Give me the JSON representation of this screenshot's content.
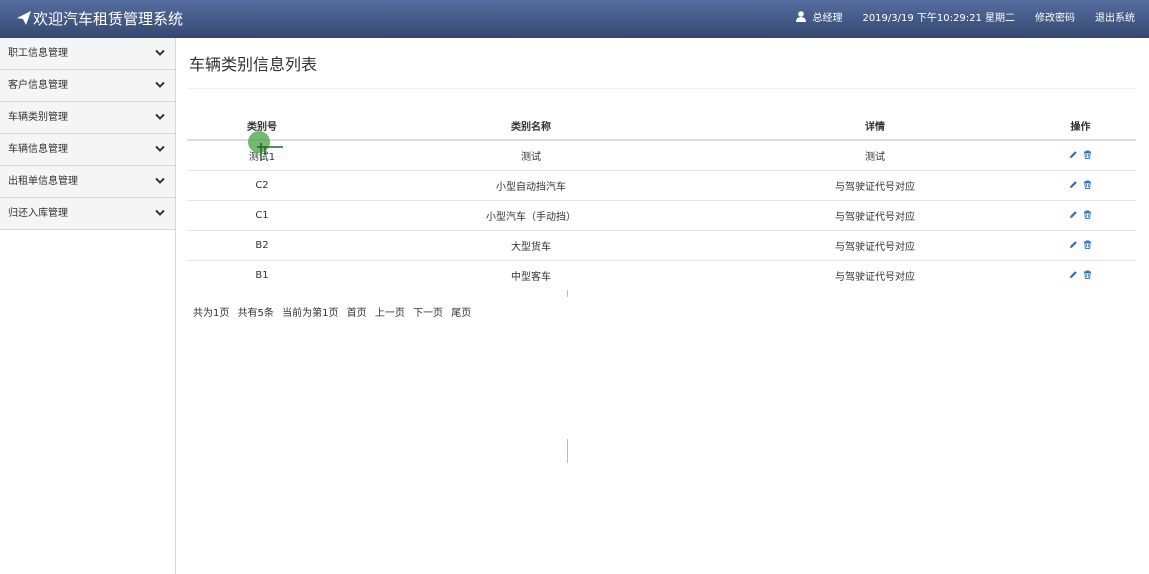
{
  "header": {
    "title": "欢迎汽车租赁管理系统",
    "user": "总经理",
    "datetime": "2019/3/19 下午10:29:21 星期二",
    "change_password": "修改密码",
    "logout": "退出系统"
  },
  "sidebar": {
    "items": [
      {
        "label": "职工信息管理"
      },
      {
        "label": "客户信息管理"
      },
      {
        "label": "车辆类别管理"
      },
      {
        "label": "车辆信息管理"
      },
      {
        "label": "出租单信息管理"
      },
      {
        "label": "归还入库管理"
      }
    ]
  },
  "main": {
    "title": "车辆类别信息列表",
    "columns": [
      "类别号",
      "类别名称",
      "详情",
      "操作"
    ],
    "rows": [
      {
        "code": "测试1",
        "name": "测试",
        "detail": "测试"
      },
      {
        "code": "C2",
        "name": "小型自动挡汽车",
        "detail": "与驾驶证代号对应"
      },
      {
        "code": "C1",
        "name": "小型汽车（手动挡）",
        "detail": "与驾驶证代号对应"
      },
      {
        "code": "B2",
        "name": "大型货车",
        "detail": "与驾驶证代号对应"
      },
      {
        "code": "B1",
        "name": "中型客车",
        "detail": "与驾驶证代号对应"
      }
    ]
  },
  "pager": {
    "total_pages": "共为1页",
    "total_items": "共有5条",
    "current": "当前为第1页",
    "first": "首页",
    "prev": "上一页",
    "next": "下一页",
    "last": "尾页"
  },
  "colors": {
    "header_top": "#556ea0",
    "header_bottom": "#34486f",
    "action_icon": "#2f6fb5",
    "cursor": "#46a046"
  },
  "icons": {
    "brand": "paper-plane-icon",
    "user": "user-icon",
    "edit": "pencil-icon",
    "delete": "trash-icon",
    "menu": "chevron-down-icon"
  }
}
